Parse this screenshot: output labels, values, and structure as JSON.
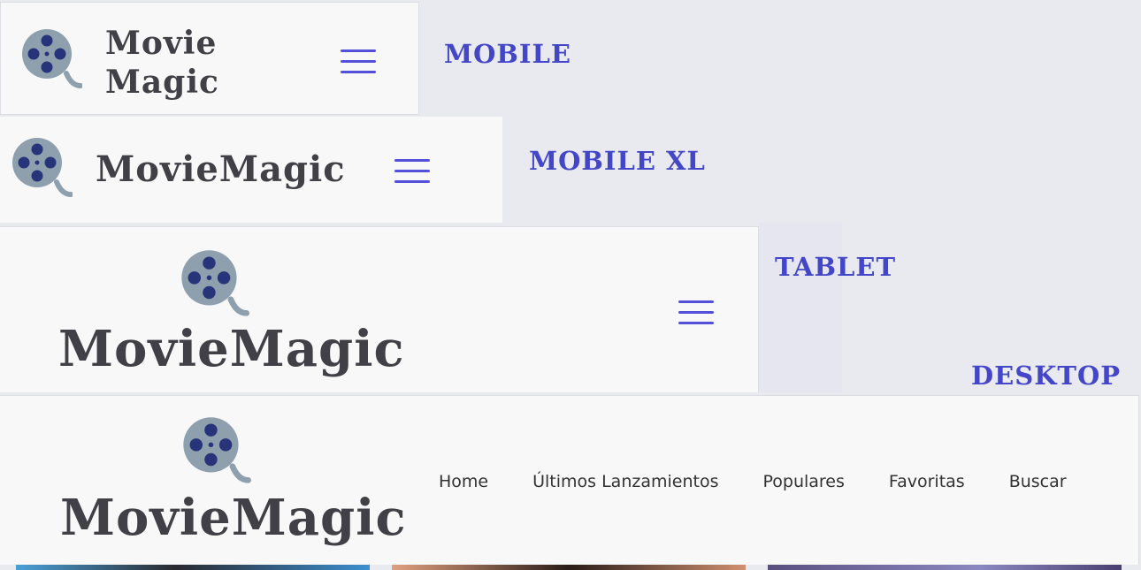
{
  "brand": {
    "line1": "Movie",
    "line2": "Magic",
    "full": "MovieMagic",
    "logo_icon": "film-reel-icon",
    "menu_icon": "hamburger-icon"
  },
  "labels": {
    "mobile": "MOBILE",
    "mobile_xl": "MOBILE XL",
    "tablet": "TABLET",
    "desktop": "DESKTOP"
  },
  "nav": [
    {
      "label": "Home"
    },
    {
      "label": "Últimos Lanzamientos"
    },
    {
      "label": "Populares"
    },
    {
      "label": "Favoritas"
    },
    {
      "label": "Buscar"
    }
  ],
  "colors": {
    "accent": "#5250d8",
    "label": "#4346c6",
    "brand_text": "#404046",
    "reel_body": "#8e9fae",
    "reel_holes": "#27347a"
  }
}
